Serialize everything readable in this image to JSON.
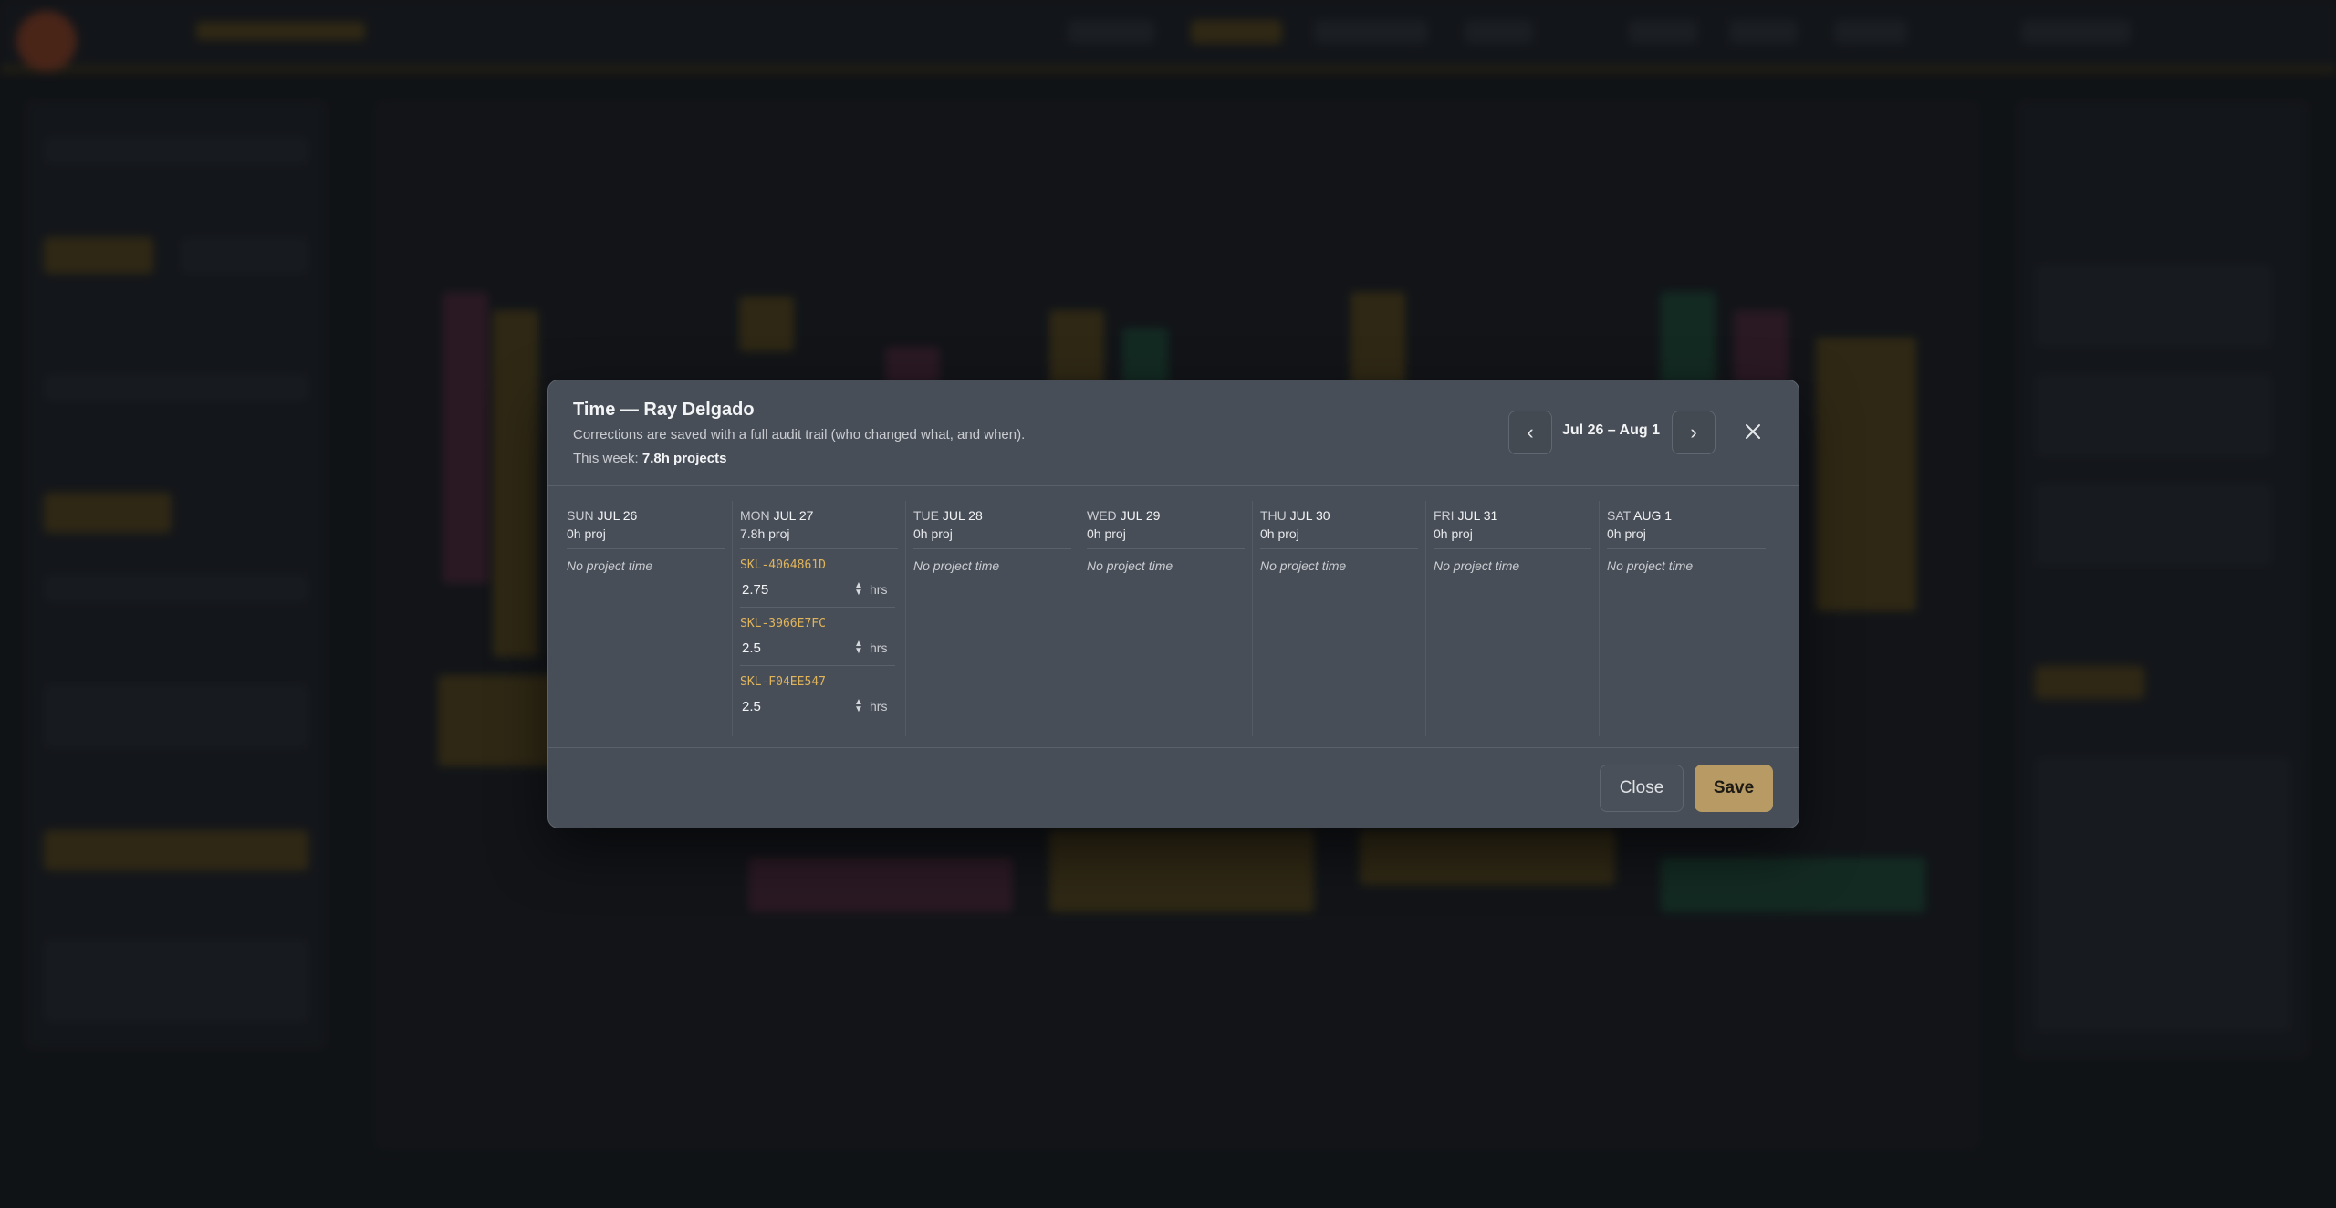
{
  "modal": {
    "title": "Time — Ray Delgado",
    "subtitle": "Corrections are saved with a full audit trail (who changed what, and when).",
    "week_prefix": "This week:",
    "week_total": "7.8h projects",
    "range_label": "Jul 26 – Aug 1",
    "prev_label": "‹",
    "next_label": "›"
  },
  "days": [
    {
      "dow": "SUN",
      "date": "JUL 26",
      "proj": "0h proj",
      "empty": "No project time"
    },
    {
      "dow": "MON",
      "date": "JUL 27",
      "proj": "7.8h proj",
      "entries": [
        {
          "code": "SKL-4064861D",
          "hours": "2.75",
          "unit": "hrs"
        },
        {
          "code": "SKL-3966E7FC",
          "hours": "2.5",
          "unit": "hrs"
        },
        {
          "code": "SKL-F04EE547",
          "hours": "2.5",
          "unit": "hrs"
        }
      ]
    },
    {
      "dow": "TUE",
      "date": "JUL 28",
      "proj": "0h proj",
      "empty": "No project time"
    },
    {
      "dow": "WED",
      "date": "JUL 29",
      "proj": "0h proj",
      "empty": "No project time"
    },
    {
      "dow": "THU",
      "date": "JUL 30",
      "proj": "0h proj",
      "empty": "No project time"
    },
    {
      "dow": "FRI",
      "date": "JUL 31",
      "proj": "0h proj",
      "empty": "No project time"
    },
    {
      "dow": "SAT",
      "date": "AUG 1",
      "proj": "0h proj",
      "empty": "No project time"
    }
  ],
  "footer": {
    "close_label": "Close",
    "save_label": "Save"
  },
  "colors": {
    "accent": "#b89a64",
    "code": "#e0b45a",
    "modal_bg": "#484e57"
  }
}
